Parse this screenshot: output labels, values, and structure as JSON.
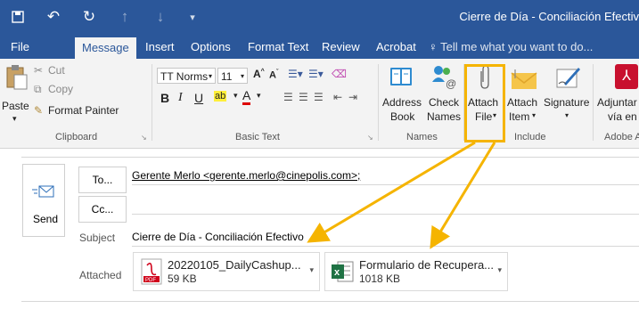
{
  "window": {
    "title": "Cierre de Día - Conciliación Efectiv"
  },
  "tabs": [
    "File",
    "Message",
    "Insert",
    "Options",
    "Format Text",
    "Review",
    "Acrobat"
  ],
  "tell_me": "Tell me what you want to do...",
  "clipboard": {
    "paste": "Paste",
    "cut": "Cut",
    "copy": "Copy",
    "format_painter": "Format Painter",
    "label": "Clipboard"
  },
  "basic_text": {
    "font": "TT Norms",
    "size": "11",
    "label": "Basic Text"
  },
  "names": {
    "address_book_1": "Address",
    "address_book_2": "Book",
    "check_names_1": "Check",
    "check_names_2": "Names",
    "label": "Names"
  },
  "include": {
    "attach_file_1": "Attach",
    "attach_file_2": "File",
    "attach_item_1": "Attach",
    "attach_item_2": "Item",
    "signature": "Signature",
    "label": "Include"
  },
  "adobe": {
    "line1": "Adjuntar",
    "line2": "vía en",
    "label": "Adobe A"
  },
  "compose": {
    "send": "Send",
    "to_button": "To...",
    "cc_button": "Cc...",
    "to_value": "Gerente Merlo <gerente.merlo@cinepolis.com>;",
    "subject_label": "Subject",
    "subject_value": "Cierre de Día - Conciliación Efectivo",
    "attached_label": "Attached"
  },
  "attachments": [
    {
      "name": "20220105_DailyCashup...",
      "size": "59 KB",
      "icon": "pdf-icon"
    },
    {
      "name": "Formulario de Recupera...",
      "size": "1018 KB",
      "icon": "excel-icon"
    }
  ],
  "colors": {
    "title_bar": "#2b579a",
    "ribbon": "#f3f3f3",
    "highlight": "#f5b400",
    "pdf": "#d0021b",
    "excel": "#1f7244"
  }
}
